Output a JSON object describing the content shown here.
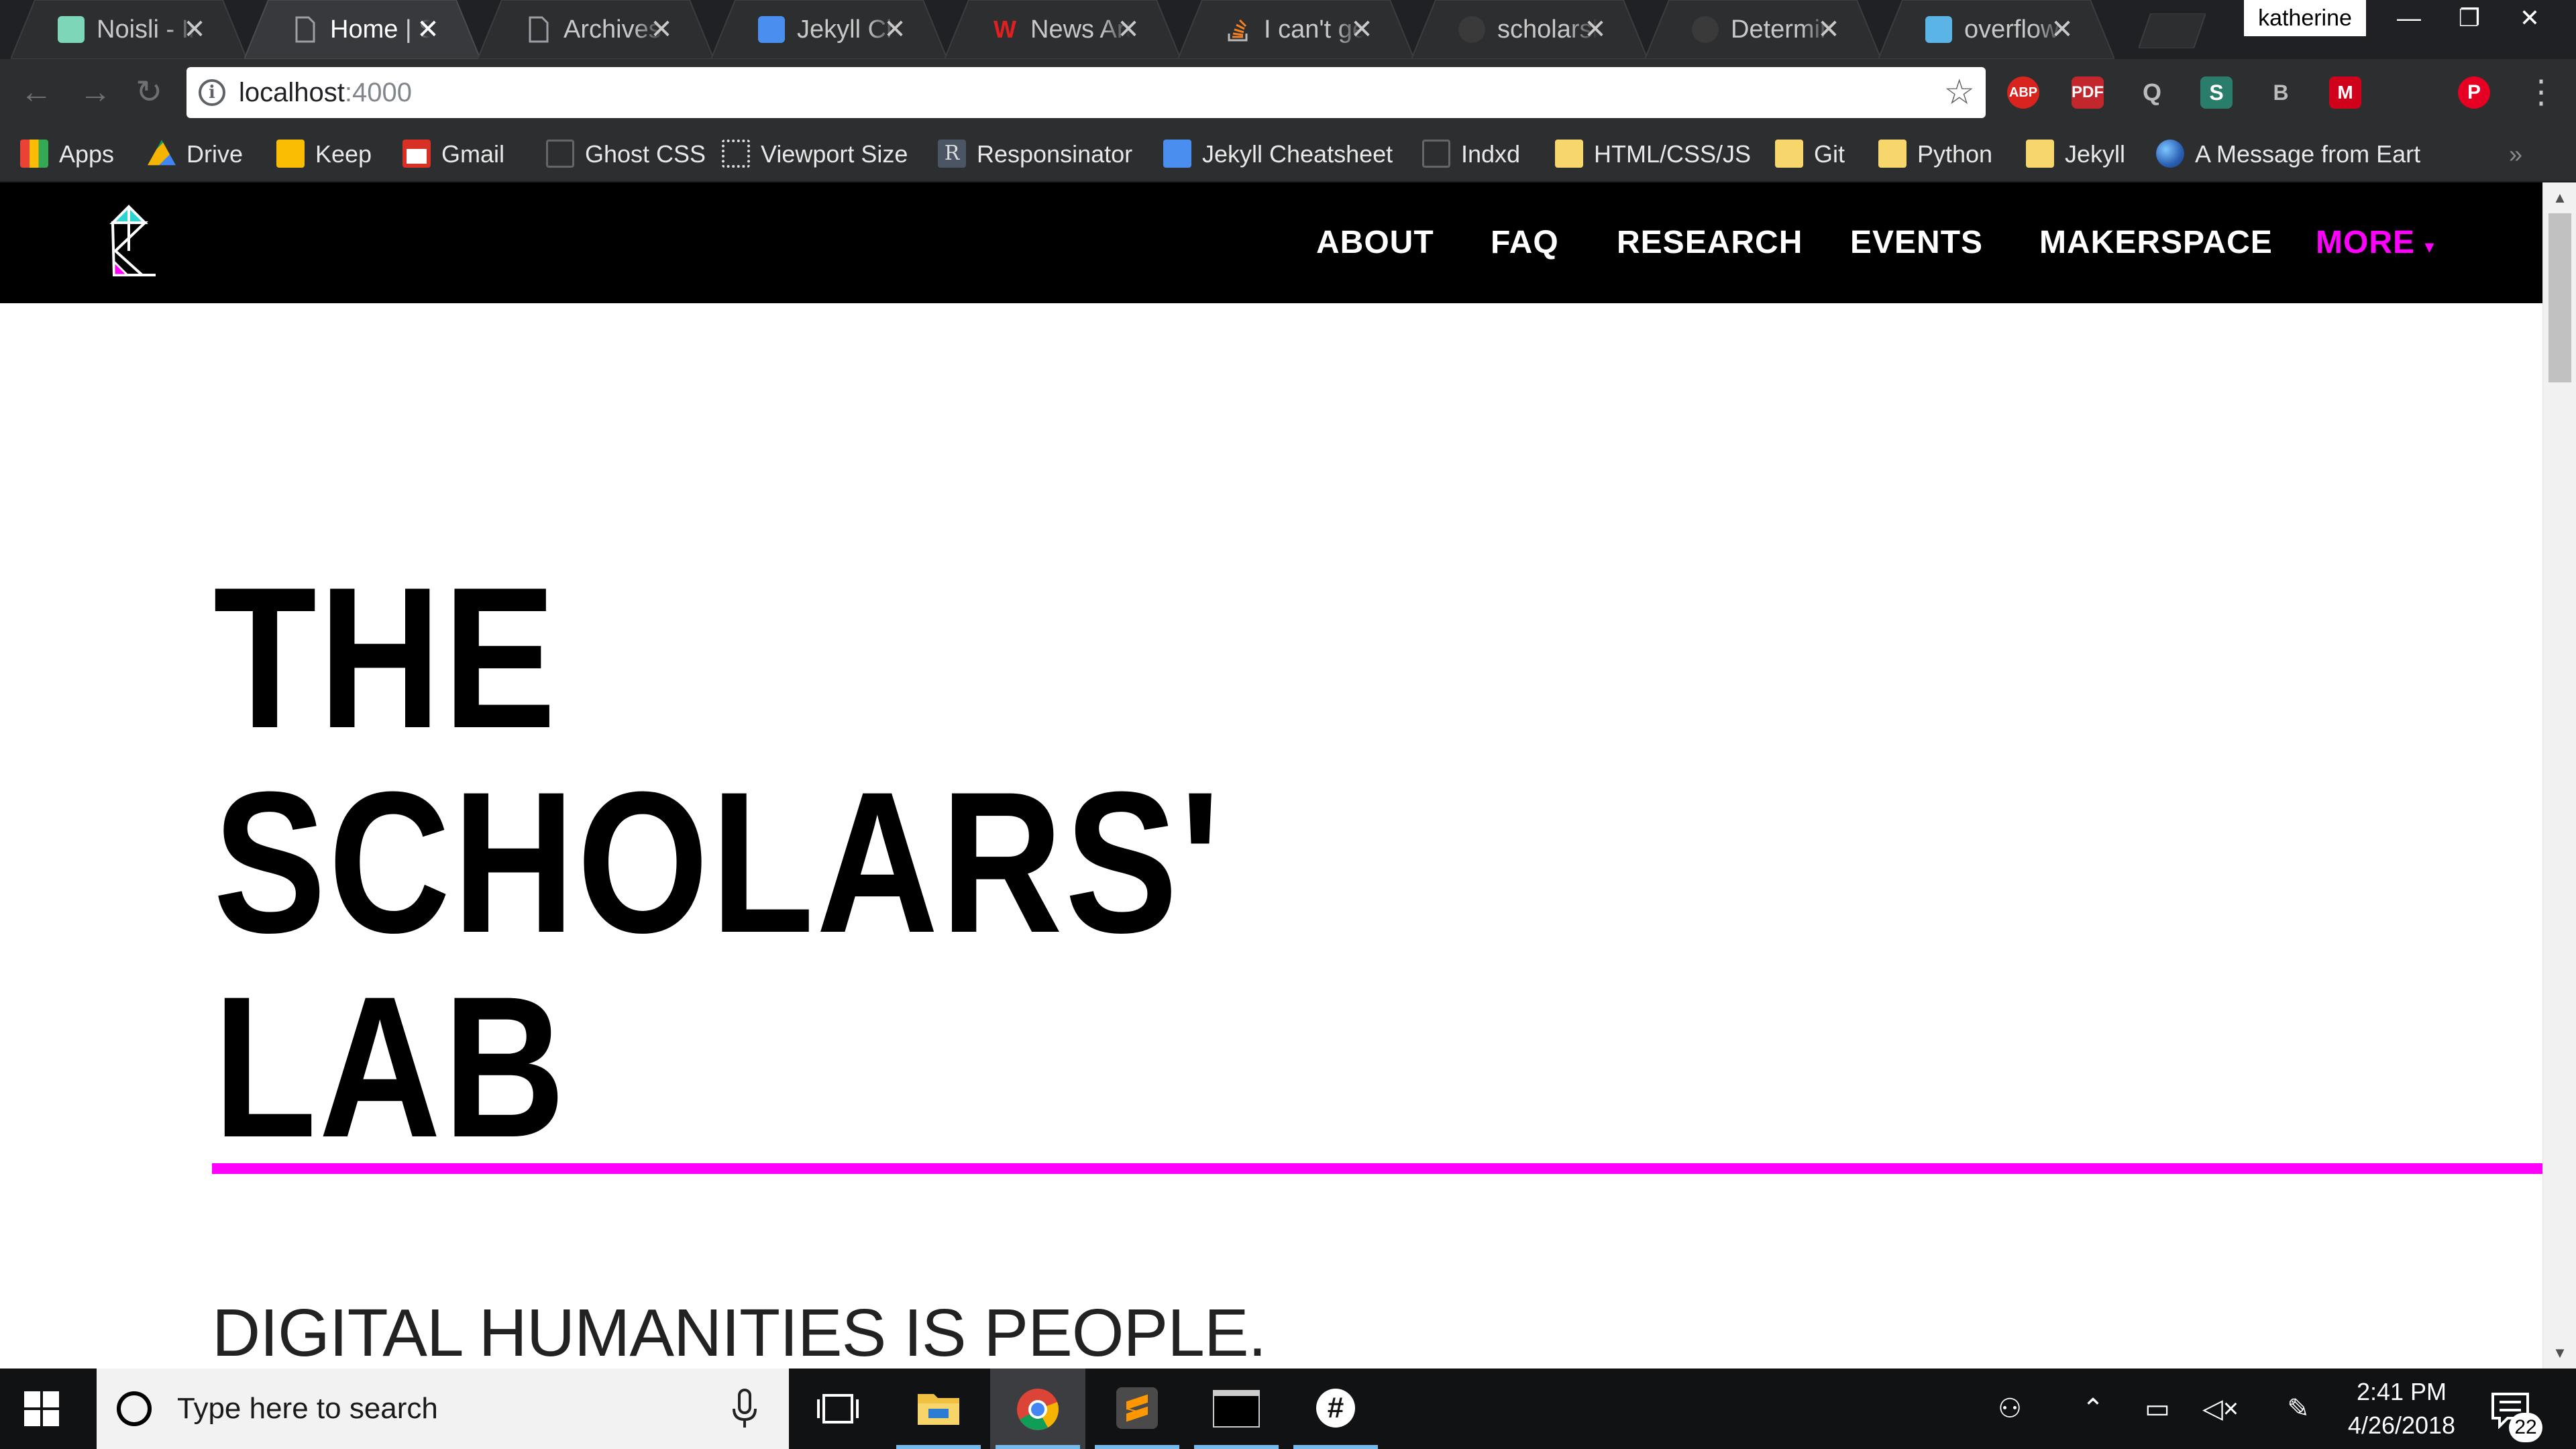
{
  "browser": {
    "tabs": [
      {
        "title": "Noisli - Im",
        "favicon": "noisli-icon",
        "color": "#7ed6b8"
      },
      {
        "title": "Home | Sc",
        "favicon": "page-icon",
        "color": "#9aa0a6"
      },
      {
        "title": "Archives |",
        "favicon": "page-icon",
        "color": "#9aa0a6"
      },
      {
        "title": "Jekyll Che",
        "favicon": "jekyll-cheatsheet-icon",
        "color": "#4a8ff0"
      },
      {
        "title": "News Artic",
        "favicon": "w-icon",
        "color": "#e02020"
      },
      {
        "title": "I can't get",
        "favicon": "stackoverflow-icon",
        "color": "#f48024"
      },
      {
        "title": "scholarslal",
        "favicon": "github-icon",
        "color": "#444"
      },
      {
        "title": "Determine",
        "favicon": "github-icon",
        "color": "#444"
      },
      {
        "title": "overflow",
        "favicon": "panther-icon",
        "color": "#5ab4e6"
      }
    ],
    "profile_name": "katherine",
    "url_host": "localhost",
    "url_port": ":4000",
    "extensions": [
      "ABP",
      "PDF",
      "Q",
      "S",
      "B",
      "M",
      "P"
    ],
    "bookmarks": [
      {
        "label": "Apps",
        "icon": "apps-grid-icon"
      },
      {
        "label": "Drive",
        "icon": "drive-icon"
      },
      {
        "label": "Keep",
        "icon": "keep-icon"
      },
      {
        "label": "Gmail",
        "icon": "gmail-icon"
      },
      {
        "label": "Ghost CSS",
        "icon": "page-icon"
      },
      {
        "label": "Viewport Size",
        "icon": "viewport-icon"
      },
      {
        "label": "Responsinator",
        "icon": "responsinator-icon"
      },
      {
        "label": "Jekyll Cheatsheet",
        "icon": "jekyll-cheatsheet-icon"
      },
      {
        "label": "Indxd",
        "icon": "page-icon"
      },
      {
        "label": "HTML/CSS/JS",
        "icon": "folder-icon"
      },
      {
        "label": "Git",
        "icon": "folder-icon"
      },
      {
        "label": "Python",
        "icon": "folder-icon"
      },
      {
        "label": "Jekyll",
        "icon": "folder-icon"
      },
      {
        "label": "A Message from Eart",
        "icon": "globe-icon"
      }
    ],
    "bookmarks_overflow": "»"
  },
  "site": {
    "nav": [
      "ABOUT",
      "FAQ",
      "RESEARCH",
      "EVENTS",
      "MAKERSPACE",
      "MORE"
    ],
    "nav_more_caret": "▾",
    "hero_lines": [
      "THE",
      "SCHOLARS'",
      "LAB"
    ],
    "tagline": "DIGITAL HUMANITIES IS PEOPLE.",
    "accent_color": "#ff00ff"
  },
  "taskbar": {
    "search_placeholder": "Type here to search",
    "time": "2:41 PM",
    "date": "4/26/2018",
    "notification_count": "22",
    "apps": [
      "file-explorer-icon",
      "chrome-icon",
      "sublime-text-icon",
      "terminal-icon",
      "slack-icon"
    ]
  }
}
